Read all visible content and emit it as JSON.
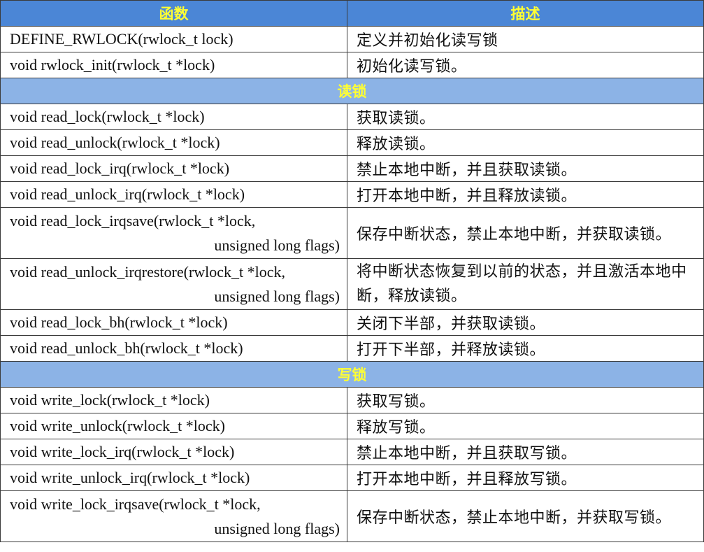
{
  "header": {
    "col_function": "函数",
    "col_description": "描述"
  },
  "general": [
    {
      "func": "DEFINE_RWLOCK(rwlock_t lock)",
      "desc": "定义并初始化读写锁"
    },
    {
      "func": "void rwlock_init(rwlock_t *lock)",
      "desc": "初始化读写锁。"
    }
  ],
  "read_section": {
    "title": "读锁",
    "rows": [
      {
        "func": "void read_lock(rwlock_t *lock)",
        "desc": "获取读锁。"
      },
      {
        "func": "void read_unlock(rwlock_t *lock)",
        "desc": "释放读锁。"
      },
      {
        "func": "void read_lock_irq(rwlock_t *lock)",
        "desc": "禁止本地中断，并且获取读锁。"
      },
      {
        "func": "void read_unlock_irq(rwlock_t *lock)",
        "desc": "打开本地中断，并且释放读锁。"
      },
      {
        "func": "void read_lock_irqsave(rwlock_t *lock,",
        "func2": "unsigned long flags)",
        "desc": "保存中断状态，禁止本地中断，并获取读锁。"
      },
      {
        "func": "void read_unlock_irqrestore(rwlock_t *lock,",
        "func2": "unsigned long flags)",
        "desc": "将中断状态恢复到以前的状态，并且激活本地中断，释放读锁。"
      },
      {
        "func": "void read_lock_bh(rwlock_t *lock)",
        "desc": "关闭下半部，并获取读锁。"
      },
      {
        "func": "void read_unlock_bh(rwlock_t *lock)",
        "desc": "打开下半部，并释放读锁。"
      }
    ]
  },
  "write_section": {
    "title": "写锁",
    "rows": [
      {
        "func": "void write_lock(rwlock_t *lock)",
        "desc": "获取写锁。"
      },
      {
        "func": "void write_unlock(rwlock_t *lock)",
        "desc": "释放写锁。"
      },
      {
        "func": "void write_lock_irq(rwlock_t *lock)",
        "desc": "禁止本地中断，并且获取写锁。"
      },
      {
        "func": "void write_unlock_irq(rwlock_t *lock)",
        "desc": "打开本地中断，并且释放写锁。"
      },
      {
        "func": "void write_lock_irqsave(rwlock_t *lock,",
        "func2": "unsigned long flags)",
        "desc": "保存中断状态，禁止本地中断，并获取写锁。"
      }
    ]
  },
  "colors": {
    "header_bg": "#4b86d6",
    "section_bg": "#8cb3e6",
    "header_text": "#ffff33"
  }
}
